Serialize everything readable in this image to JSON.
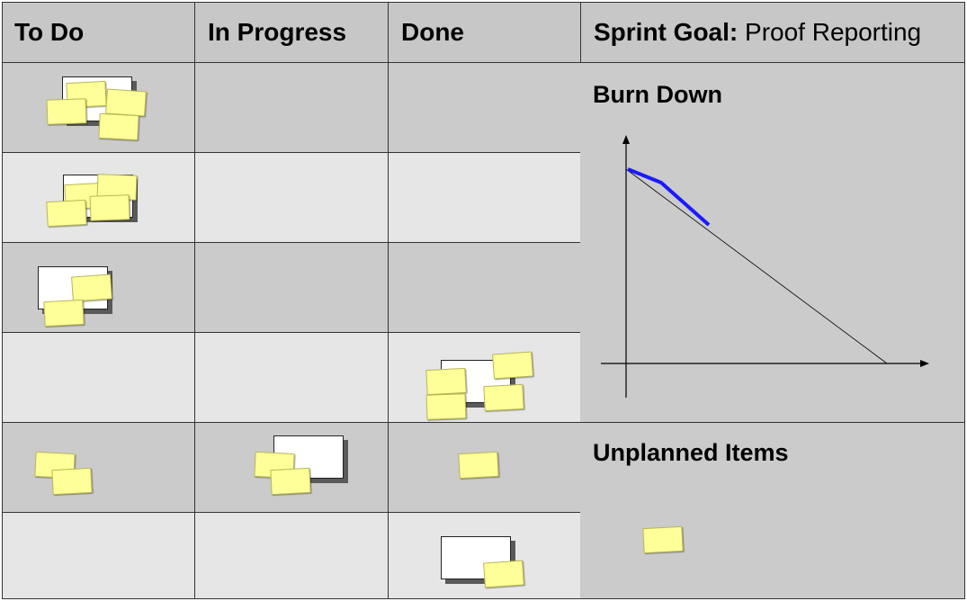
{
  "columns": {
    "todo": "To Do",
    "in_progress": "In Progress",
    "done": "Done"
  },
  "sprint_goal": {
    "label": "Sprint Goal:",
    "value": "Proof Reporting"
  },
  "burn_down": {
    "title": "Burn Down"
  },
  "unplanned": {
    "title": "Unplanned Items"
  },
  "colors": {
    "sticky_note": "#ffff99",
    "burn_line": "#1a1aff",
    "row_dark": "#cbcbcb",
    "row_light": "#e6e6e6"
  }
}
